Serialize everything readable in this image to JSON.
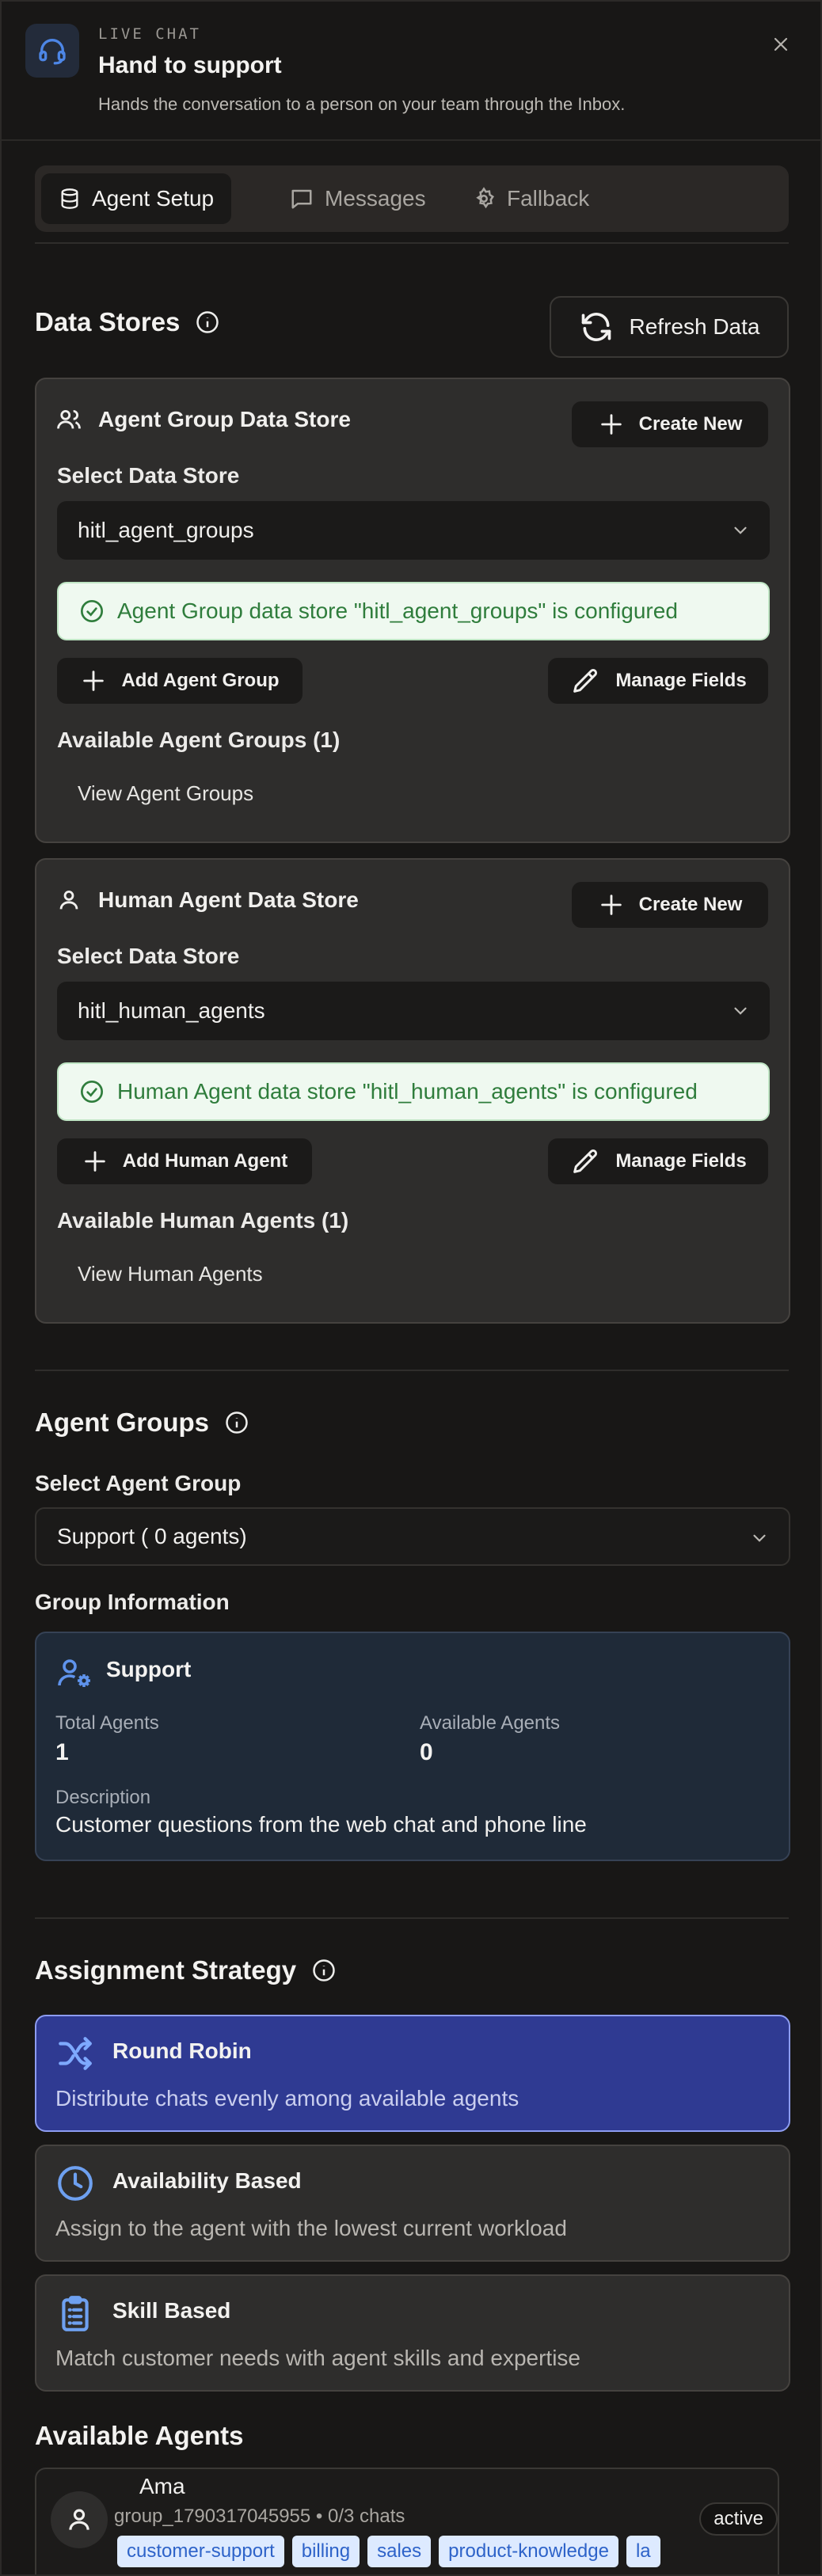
{
  "header": {
    "kicker": "LIVE CHAT",
    "title": "Hand to support",
    "subtitle": "Hands the conversation to a person on your team through the Inbox."
  },
  "tabs": [
    {
      "label": "Agent Setup",
      "icon": "database-icon",
      "active": true
    },
    {
      "label": "Messages",
      "icon": "chat-bubble-icon",
      "active": false
    },
    {
      "label": "Fallback",
      "icon": "gear-icon",
      "active": false
    }
  ],
  "data_stores": {
    "title": "Data Stores",
    "refresh_label": "Refresh Data",
    "agent_group": {
      "title": "Agent Group Data Store",
      "create_label": "Create New",
      "select_label": "Select Data Store",
      "selected": "hitl_agent_groups",
      "status": "Agent Group data store \"hitl_agent_groups\" is configured",
      "add_label": "Add Agent Group",
      "manage_label": "Manage Fields",
      "available_label": "Available Agent Groups (1)",
      "view_label": "View Agent Groups"
    },
    "human_agent": {
      "title": "Human Agent Data Store",
      "create_label": "Create New",
      "select_label": "Select Data Store",
      "selected": "hitl_human_agents",
      "status": "Human Agent data store \"hitl_human_agents\" is configured",
      "add_label": "Add Human Agent",
      "manage_label": "Manage Fields",
      "available_label": "Available Human Agents (1)",
      "view_label": "View Human Agents"
    }
  },
  "agent_groups": {
    "title": "Agent Groups",
    "select_label": "Select Agent Group",
    "selected": "Support ( 0 agents)",
    "info_label": "Group Information",
    "group": {
      "name": "Support",
      "total_label": "Total Agents",
      "total_value": "1",
      "available_label": "Available Agents",
      "available_value": "0",
      "description_label": "Description",
      "description": "Customer questions from the web chat and phone line"
    }
  },
  "assignment": {
    "title": "Assignment Strategy",
    "options": [
      {
        "title": "Round Robin",
        "desc": "Distribute chats evenly among available agents",
        "icon": "shuffle-icon",
        "selected": true
      },
      {
        "title": "Availability Based",
        "desc": "Assign to the agent with the lowest current workload",
        "icon": "clock-icon",
        "selected": false
      },
      {
        "title": "Skill Based",
        "desc": "Match customer needs with agent skills and expertise",
        "icon": "clipboard-icon",
        "selected": false
      }
    ]
  },
  "available_agents": {
    "title": "Available Agents",
    "agents": [
      {
        "name": "Ama",
        "meta": "group_1790317045955 • 0/3 chats",
        "status": "active",
        "tags": [
          "customer-support",
          "billing",
          "sales",
          "product-knowledge",
          "la"
        ]
      }
    ]
  },
  "colors": {
    "background": "#181716",
    "card": "#2e2d2c",
    "accent_blue": "#2f3a92",
    "success_bg": "#eff9f0",
    "success_text": "#2f7d3c",
    "tag_bg": "#ddeaff",
    "tag_text": "#2e63c9"
  }
}
